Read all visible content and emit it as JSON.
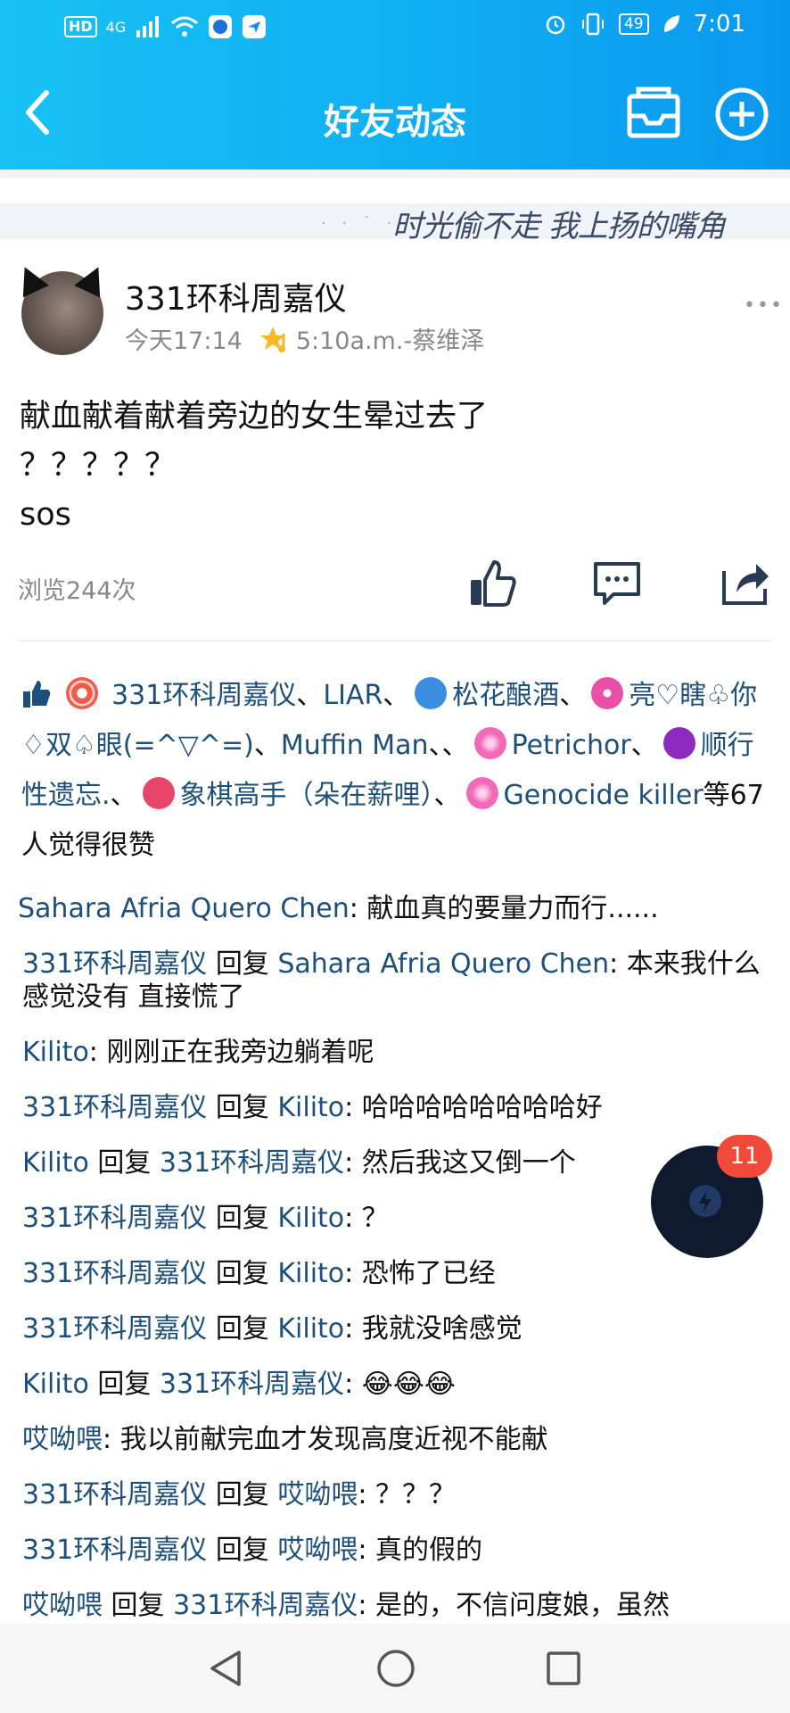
{
  "status": {
    "network": "4G",
    "net_sub": "HD",
    "battery": "49",
    "time": "7:01"
  },
  "header": {
    "title": "好友动态"
  },
  "banner": {
    "text": "时光偷不走 我上扬的嘴角"
  },
  "post": {
    "author": "331环科周嘉仪",
    "time": "今天17:14",
    "song": "5:10a.m.-蔡维泽",
    "lines": [
      "献血献着献着旁边的女生晕过去了",
      "？？？？？",
      "sos"
    ],
    "views": "浏览244次"
  },
  "likes": {
    "n1": "331环科周嘉仪",
    "sep1": "、",
    "n2": "LIAR",
    "sep2": "、",
    "n3": "松花酿酒",
    "sep3": "、",
    "n4": "亮♡瞎♧你♢双♤眼(=^▽^=)",
    "sep4": "、",
    "n5": "Muffin Man",
    "sep5": "、、",
    "n6": "Petrichor",
    "sep6": "、",
    "n7": "顺行性遗忘.",
    "sep7": "、",
    "n8": "象棋高手（朵在薪哩）",
    "sep8": "、",
    "n9": "Genocide killer",
    "suffix": "等67人觉得很赞"
  },
  "comments": [
    {
      "from": "Sahara Afria Quero Chen",
      "to": "",
      "text": ": 献血真的要量力而行......"
    },
    {
      "from": "331环科周嘉仪",
      "to": "Sahara Afria Quero Chen",
      "text": ": 本来我什么感觉没有 直接慌了"
    },
    {
      "from": "Kilito",
      "to": "",
      "text": ": 刚刚正在我旁边躺着呢"
    },
    {
      "from": "331环科周嘉仪",
      "to": "Kilito",
      "text": ": 哈哈哈哈哈哈哈哈好"
    },
    {
      "from": "Kilito",
      "to": "331环科周嘉仪",
      "text": ": 然后我这又倒一个"
    },
    {
      "from": "331环科周嘉仪",
      "to": "Kilito",
      "text": ": ？"
    },
    {
      "from": "331环科周嘉仪",
      "to": "Kilito",
      "text": ": 恐怖了已经"
    },
    {
      "from": "331环科周嘉仪",
      "to": "Kilito",
      "text": ": 我就没啥感觉"
    },
    {
      "from": "Kilito",
      "to": "331环科周嘉仪",
      "text": ": 😂😂😂"
    },
    {
      "from": "哎呦喂",
      "to": "",
      "text": ": 我以前献完血才发现高度近视不能献"
    },
    {
      "from": "331环科周嘉仪",
      "to": "哎呦喂",
      "text": ": ？？？"
    },
    {
      "from": "331环科周嘉仪",
      "to": "哎呦喂",
      "text": ": 真的假的"
    },
    {
      "from": "哎呦喂",
      "to": "331环科周嘉仪",
      "text": ": 是的，不信问度娘，虽然"
    }
  ],
  "reply_word": "回复",
  "fab": {
    "badge": "11"
  },
  "colors": {
    "header": "#10aef2",
    "link": "#1d4f7a",
    "badge": "#f24a3a"
  }
}
